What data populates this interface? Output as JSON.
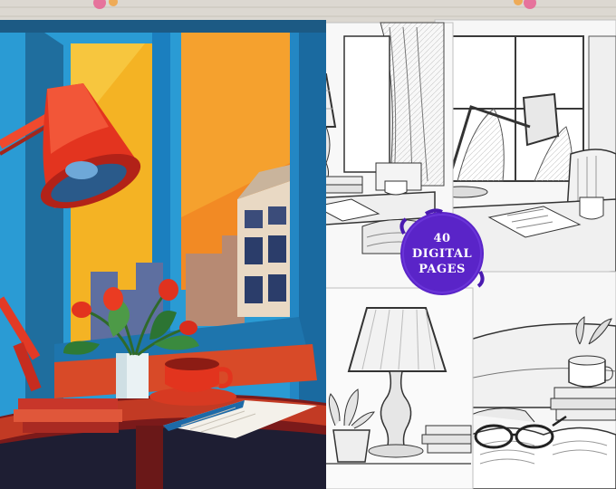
{
  "colors": {
    "wood_background": "#d9d4cc",
    "badge": "#5a24c8",
    "badge_text": "#ffffff",
    "cover_wall": "#2d9ed6",
    "cover_window_orange": "#f08a2a",
    "cover_lamp_red": "#e0321e",
    "cover_table": "#8a1e1e"
  },
  "badge": {
    "count": "40",
    "line2": "DIGITAL",
    "line3": "PAGES"
  }
}
